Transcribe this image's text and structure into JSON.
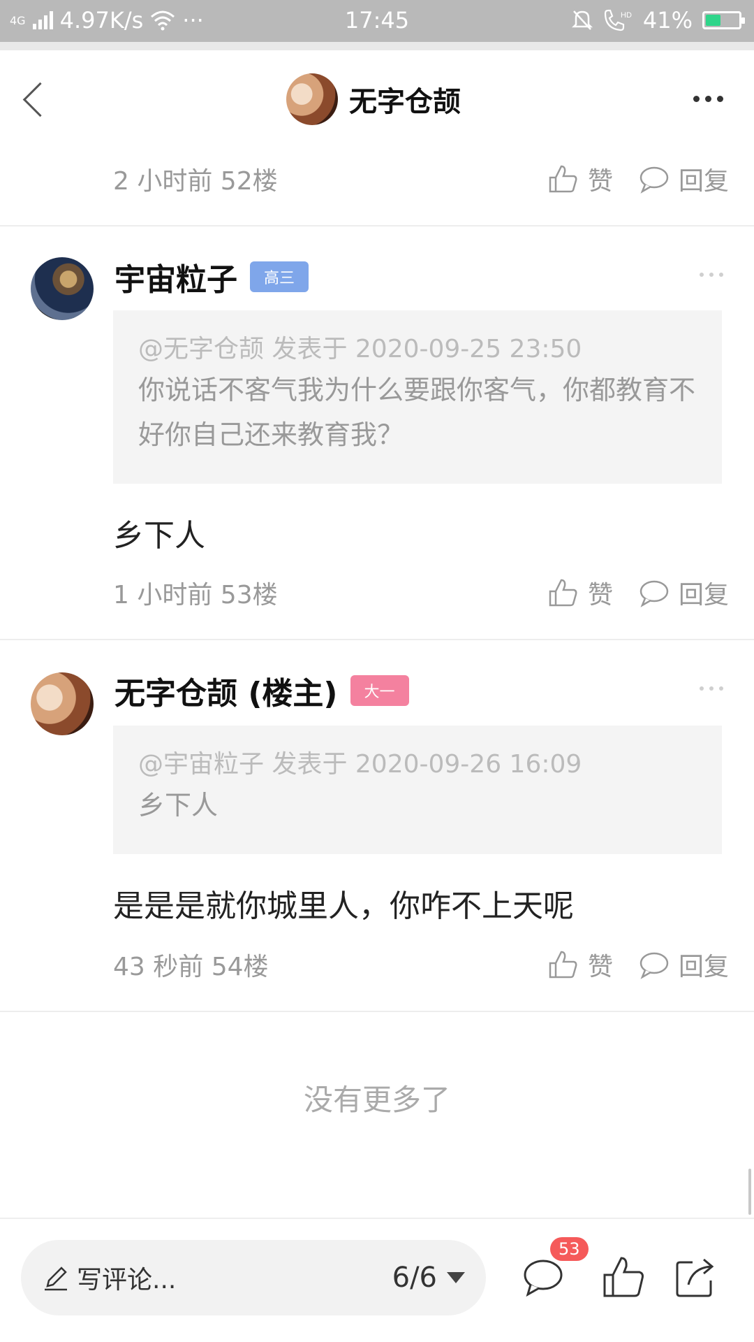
{
  "status_bar": {
    "network_type": "4G",
    "speed": "4.97K/s",
    "more": "···",
    "time": "17:45",
    "hd_label": "HD",
    "battery": "41%",
    "battery_level": 0.41,
    "colors": {
      "background": "#b9b9b9",
      "battery_fill": "#2fd58a"
    }
  },
  "header": {
    "title": "无字仓颉",
    "back_icon": "chevron-left-icon",
    "more_icon": "more-horizontal-icon"
  },
  "top_meta": {
    "text": "2 小时前  52楼",
    "like_label": "赞",
    "reply_label": "回复"
  },
  "comments": [
    {
      "username": "宇宙粒子",
      "badge": "高三",
      "badge_color": "#7fa6ea",
      "quote_head": "@无字仓颉 发表于 2020-09-25 23:50",
      "quote_body": "你说话不客气我为什么要跟你客气，你都教育不好你自己还来教育我？",
      "text": "乡下人",
      "meta": "1 小时前  53楼",
      "like_label": "赞",
      "reply_label": "回复"
    },
    {
      "username": "无字仓颉 (楼主)",
      "badge": "大一",
      "badge_color": "#f4819f",
      "quote_head": "@宇宙粒子 发表于 2020-09-26 16:09",
      "quote_body": "乡下人",
      "text": "是是是就你城里人，你咋不上天呢",
      "meta": "43 秒前  54楼",
      "like_label": "赞",
      "reply_label": "回复"
    }
  ],
  "footer_note": "没有更多了",
  "bottom_bar": {
    "input_placeholder": "写评论...",
    "page_indicator": "6/6",
    "comment_count": "53",
    "icons": [
      "pen-icon",
      "dropdown-triangle-icon",
      "comment-icon",
      "like-icon",
      "share-icon"
    ],
    "colors": {
      "badge": "#f55a5a"
    }
  }
}
